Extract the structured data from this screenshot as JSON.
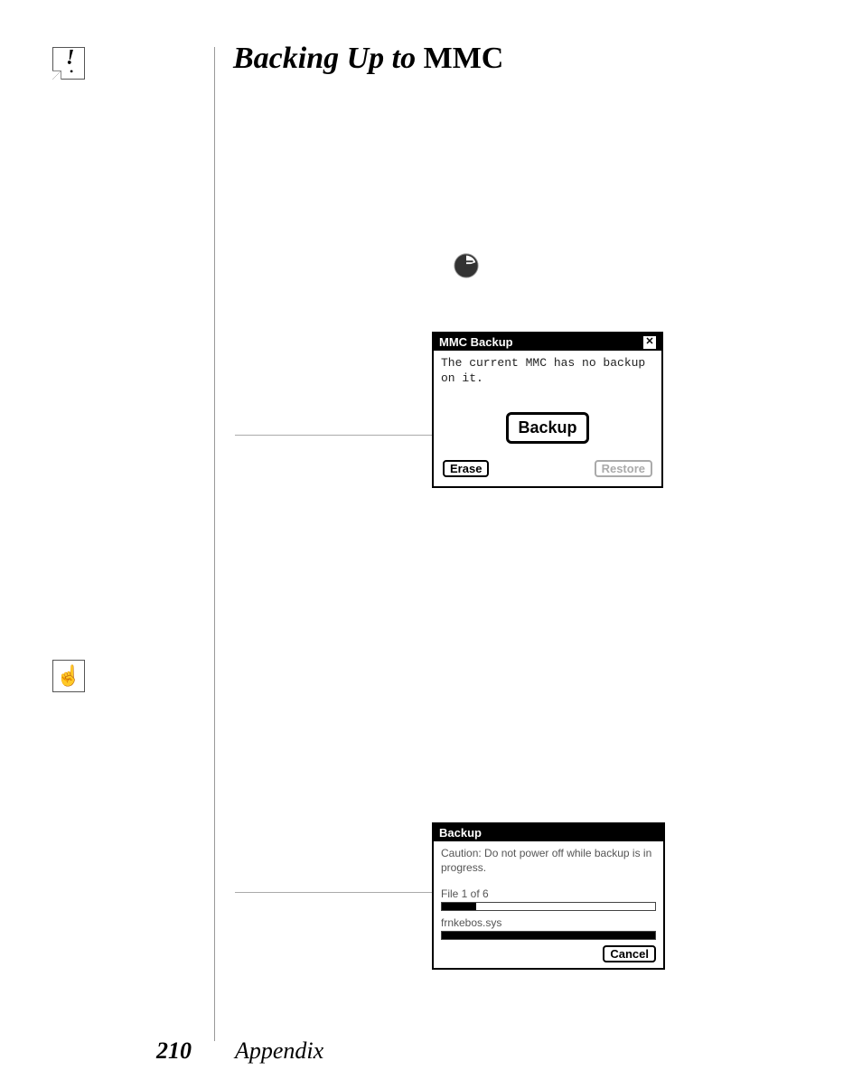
{
  "section_title_italic": "Backing Up to ",
  "section_title_roman": "MMC",
  "dialog1": {
    "title": "MMC Backup",
    "message": "The current MMC has no backup on it.",
    "backup_label": "Backup",
    "erase_label": "Erase",
    "restore_label": "Restore"
  },
  "dialog2": {
    "title": "Backup",
    "caution": "Caution: Do not power off while backup is in progress.",
    "file_count": "File 1 of 6",
    "filename": "frnkebos.sys",
    "cancel_label": "Cancel"
  },
  "footer": {
    "page": "210",
    "label": "Appendix"
  }
}
